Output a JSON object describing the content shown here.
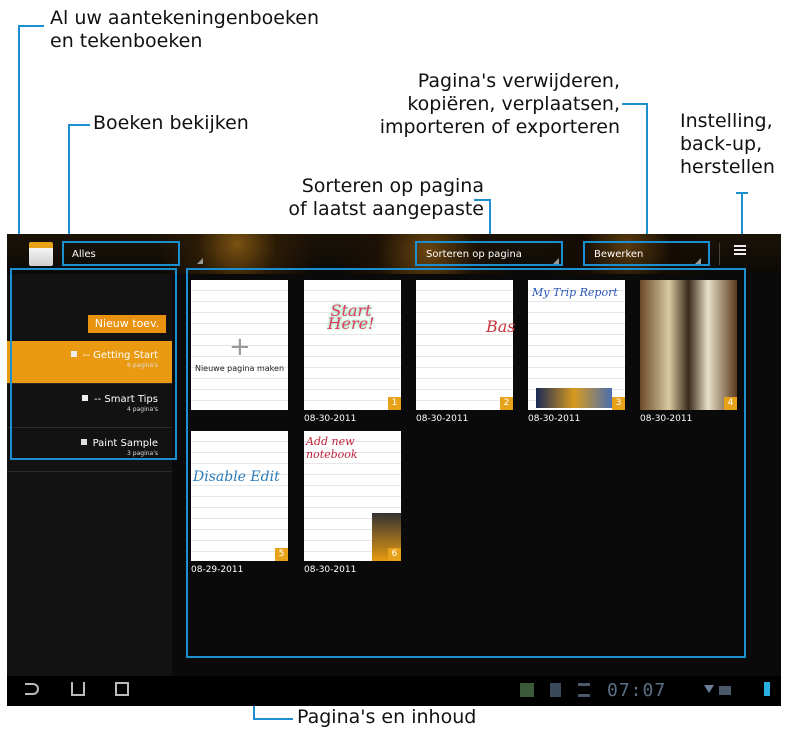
{
  "callouts": {
    "notebooks": [
      "Al uw aantekeningenboeken",
      "en tekenboeken"
    ],
    "view_books": "Boeken bekijken",
    "edit_pages": [
      "Pagina's verwijderen,",
      "kopiëren, verplaatsen,",
      "importeren of exporteren"
    ],
    "settings": [
      "Instelling,",
      "back-up,",
      "herstellen"
    ],
    "sort": [
      "Sorteren op pagina",
      "of laatst aangepaste"
    ],
    "pages_content": "Pagina's en inhoud"
  },
  "topbar": {
    "view_dropdown": "Alles",
    "sort_dropdown": "Sorteren op pagina",
    "edit_dropdown": "Bewerken"
  },
  "sidebar": {
    "add_button": "Nieuw toev.",
    "notebooks": [
      {
        "title": "-- Getting Start",
        "count": "6 pagina's",
        "selected": true
      },
      {
        "title": "-- Smart Tips",
        "count": "4 pagina's",
        "selected": false
      },
      {
        "title": "Paint Sample",
        "count": "3 pagina's",
        "selected": false
      }
    ]
  },
  "pages": [
    {
      "label": "Nieuwe pagina maken",
      "date": ""
    },
    {
      "number": "1",
      "date": "08-30-2011",
      "sketch": "Start Here!"
    },
    {
      "number": "2",
      "date": "08-30-2011",
      "sketch": "Bas"
    },
    {
      "number": "3",
      "date": "08-30-2011",
      "sketch": "My Trip Report"
    },
    {
      "number": "4",
      "date": "08-30-2011"
    },
    {
      "number": "5",
      "date": "08-29-2011",
      "sketch": "Disable Edit"
    },
    {
      "number": "6",
      "date": "08-30-2011",
      "sketch": "Add new notebook"
    }
  ],
  "statusbar": {
    "clock": "07:07"
  },
  "colors": {
    "accent": "#e8a21a",
    "callout_line": "#1b8fd0",
    "screen_bg": "#0a0a0a"
  }
}
